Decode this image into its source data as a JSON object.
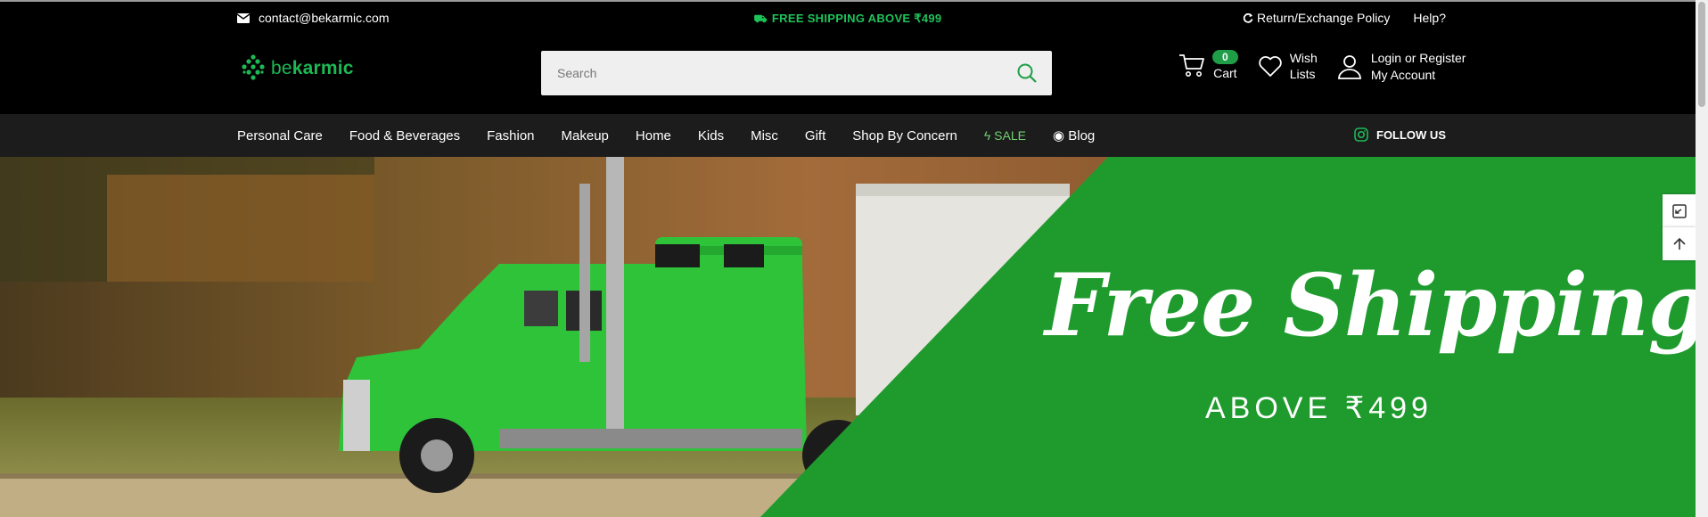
{
  "topbar": {
    "email": "contact@bekarmic.com",
    "promo": "FREE SHIPPING ABOVE ₹499",
    "return_policy": "Return/Exchange Policy",
    "help": "Help?"
  },
  "header": {
    "logo_be": "be",
    "logo_karmic": "karmic",
    "search_placeholder": "Search",
    "cart_count": "0",
    "cart_label": "Cart",
    "wish_line1": "Wish",
    "wish_line2": "Lists",
    "login_line1": "Login or Register",
    "login_line2": "My Account"
  },
  "nav": {
    "items": [
      "Personal Care",
      "Food & Beverages",
      "Fashion",
      "Makeup",
      "Home",
      "Kids",
      "Misc",
      "Gift",
      "Shop By Concern"
    ],
    "sale": "SALE",
    "blog": "Blog",
    "follow": "FOLLOW US"
  },
  "banner": {
    "title": "Free Shipping!",
    "subtitle": "ABOVE ₹499"
  },
  "colors": {
    "brand_green": "#1db954",
    "banner_green": "#1f9b2e",
    "promo_green": "#1ec35a"
  }
}
